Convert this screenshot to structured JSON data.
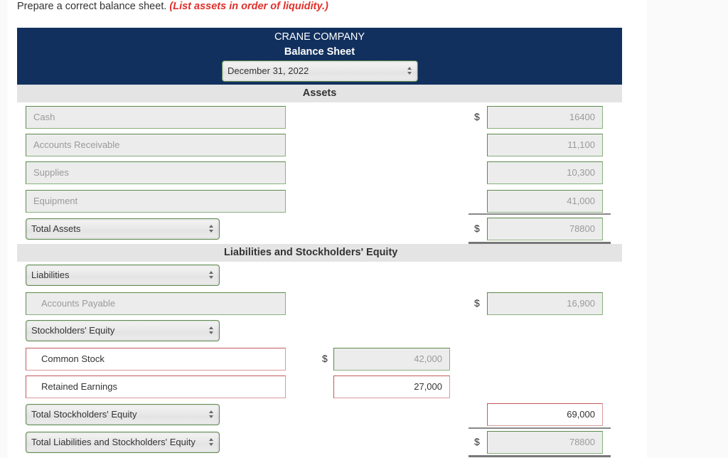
{
  "instruction": {
    "text": "Prepare a correct balance sheet.",
    "hint": "(List assets in order of liquidity.)"
  },
  "header": {
    "company": "CRANE COMPANY",
    "title": "Balance Sheet",
    "date_select": "December 31, 2022"
  },
  "colors": {
    "header_bg": "#12305e",
    "band_bg": "#e4e4e4",
    "correct_border": "#5b8a4c",
    "incorrect_border": "#c25a5a",
    "hint_red": "#e0302a"
  },
  "assets": {
    "heading": "Assets",
    "rows": [
      {
        "label": "Cash",
        "value": "16400",
        "dollar": "$"
      },
      {
        "label": "Accounts Receivable",
        "value": "11,100",
        "dollar": ""
      },
      {
        "label": "Supplies",
        "value": "10,300",
        "dollar": ""
      },
      {
        "label": "Equipment",
        "value": "41,000",
        "dollar": ""
      }
    ],
    "total_select": "Total Assets",
    "total_value": "78800",
    "total_dollar": "$"
  },
  "liabilities_equity": {
    "heading": "Liabilities and Stockholders' Equity",
    "liabilities_select": "Liabilities",
    "liabilities_rows": [
      {
        "label": "Accounts Payable",
        "value": "16,900",
        "dollar": "$"
      }
    ],
    "equity_select": "Stockholders' Equity",
    "equity_rows": [
      {
        "label": "Common Stock",
        "value": "42,000",
        "dollar": "$"
      },
      {
        "label": "Retained Earnings",
        "value": "27,000",
        "dollar": ""
      }
    ],
    "total_equity_select": "Total Stockholders' Equity",
    "total_equity_value": "69,000",
    "total_le_select": "Total Liabilities and Stockholders' Equity",
    "total_le_value": "78800",
    "total_le_dollar": "$"
  }
}
